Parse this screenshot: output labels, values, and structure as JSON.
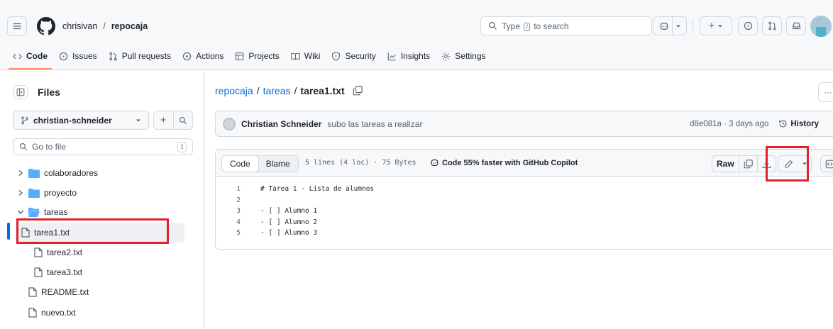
{
  "header": {
    "owner": "chrisivan",
    "separator": "/",
    "repo": "repocaja",
    "search_placeholder": "Type",
    "search_key": "/",
    "search_suffix": "to search",
    "create_label": "+"
  },
  "tabs": [
    {
      "label": "Code",
      "icon": "code-icon",
      "active": true
    },
    {
      "label": "Issues",
      "icon": "issue-opened-icon"
    },
    {
      "label": "Pull requests",
      "icon": "git-pull-request-icon"
    },
    {
      "label": "Actions",
      "icon": "play-icon"
    },
    {
      "label": "Projects",
      "icon": "table-icon"
    },
    {
      "label": "Wiki",
      "icon": "book-icon"
    },
    {
      "label": "Security",
      "icon": "shield-icon"
    },
    {
      "label": "Insights",
      "icon": "graph-icon"
    },
    {
      "label": "Settings",
      "icon": "gear-icon"
    }
  ],
  "sidebar": {
    "title": "Files",
    "branch": "christian-schneider",
    "add_label": "+",
    "go_to_file": "Go to file",
    "go_to_file_key": "t",
    "tree": [
      {
        "label": "colaboradores",
        "type": "folder",
        "expanded": false
      },
      {
        "label": "proyecto",
        "type": "folder",
        "expanded": false
      },
      {
        "label": "tareas",
        "type": "folder",
        "expanded": true
      },
      {
        "label": "tarea1.txt",
        "type": "file",
        "selected": true
      },
      {
        "label": "tarea2.txt",
        "type": "file"
      },
      {
        "label": "tarea3.txt",
        "type": "file"
      },
      {
        "label": "README.txt",
        "type": "file"
      },
      {
        "label": "nuevo.txt",
        "type": "file"
      }
    ]
  },
  "breadcrumb": {
    "repo": "repocaja",
    "folder": "tareas",
    "file": "tarea1.txt",
    "sep": "/"
  },
  "more_label": "···",
  "commit": {
    "author": "Christian Schneider",
    "message": "subo las tareas a realizar",
    "meta": "d8e081a · 3 days ago",
    "history": "History"
  },
  "viewer": {
    "code_tab": "Code",
    "blame_tab": "Blame",
    "line_info": "5 lines (4 loc) · 75 Bytes",
    "copilot": "Code 55% faster with GitHub Copilot",
    "raw": "Raw",
    "lines": [
      {
        "n": "1",
        "text": "# Tarea 1 - Lista de alumnos"
      },
      {
        "n": "2",
        "text": ""
      },
      {
        "n": "3",
        "text": "- [ ] Alumno 1"
      },
      {
        "n": "4",
        "text": "- [ ] Alumno 2"
      },
      {
        "n": "5",
        "text": "- [ ] Alumno 3"
      }
    ]
  },
  "colors": {
    "accent": "#0969da",
    "highlight": "#e1212b",
    "tab_underline": "#fd8c73",
    "folder": "#54aeff"
  }
}
